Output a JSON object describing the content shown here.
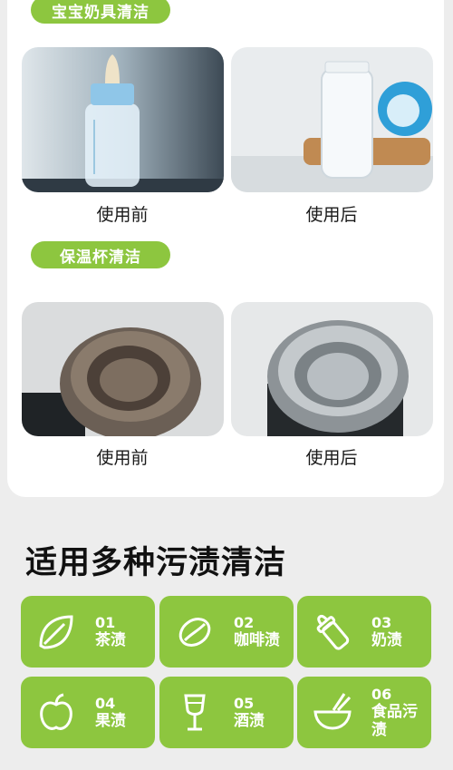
{
  "sections": [
    {
      "title": "宝宝奶具清洁",
      "before": "使用前",
      "after": "使用后"
    },
    {
      "title": "保温杯清洁",
      "before": "使用前",
      "after": "使用后"
    }
  ],
  "stains": {
    "heading": "适用多种污渍清洁",
    "items": [
      {
        "num": "01",
        "label": "茶渍",
        "icon": "leaf-icon"
      },
      {
        "num": "02",
        "label": "咖啡渍",
        "icon": "coffee-bean-icon"
      },
      {
        "num": "03",
        "label": "奶渍",
        "icon": "baby-bottle-icon"
      },
      {
        "num": "04",
        "label": "果渍",
        "icon": "apple-icon"
      },
      {
        "num": "05",
        "label": "酒渍",
        "icon": "wine-glass-icon"
      },
      {
        "num": "06",
        "label": "食品污渍",
        "icon": "food-bowl-icon"
      }
    ]
  },
  "colors": {
    "accent": "#8dc63f",
    "background": "#ededed",
    "card": "#ffffff"
  }
}
